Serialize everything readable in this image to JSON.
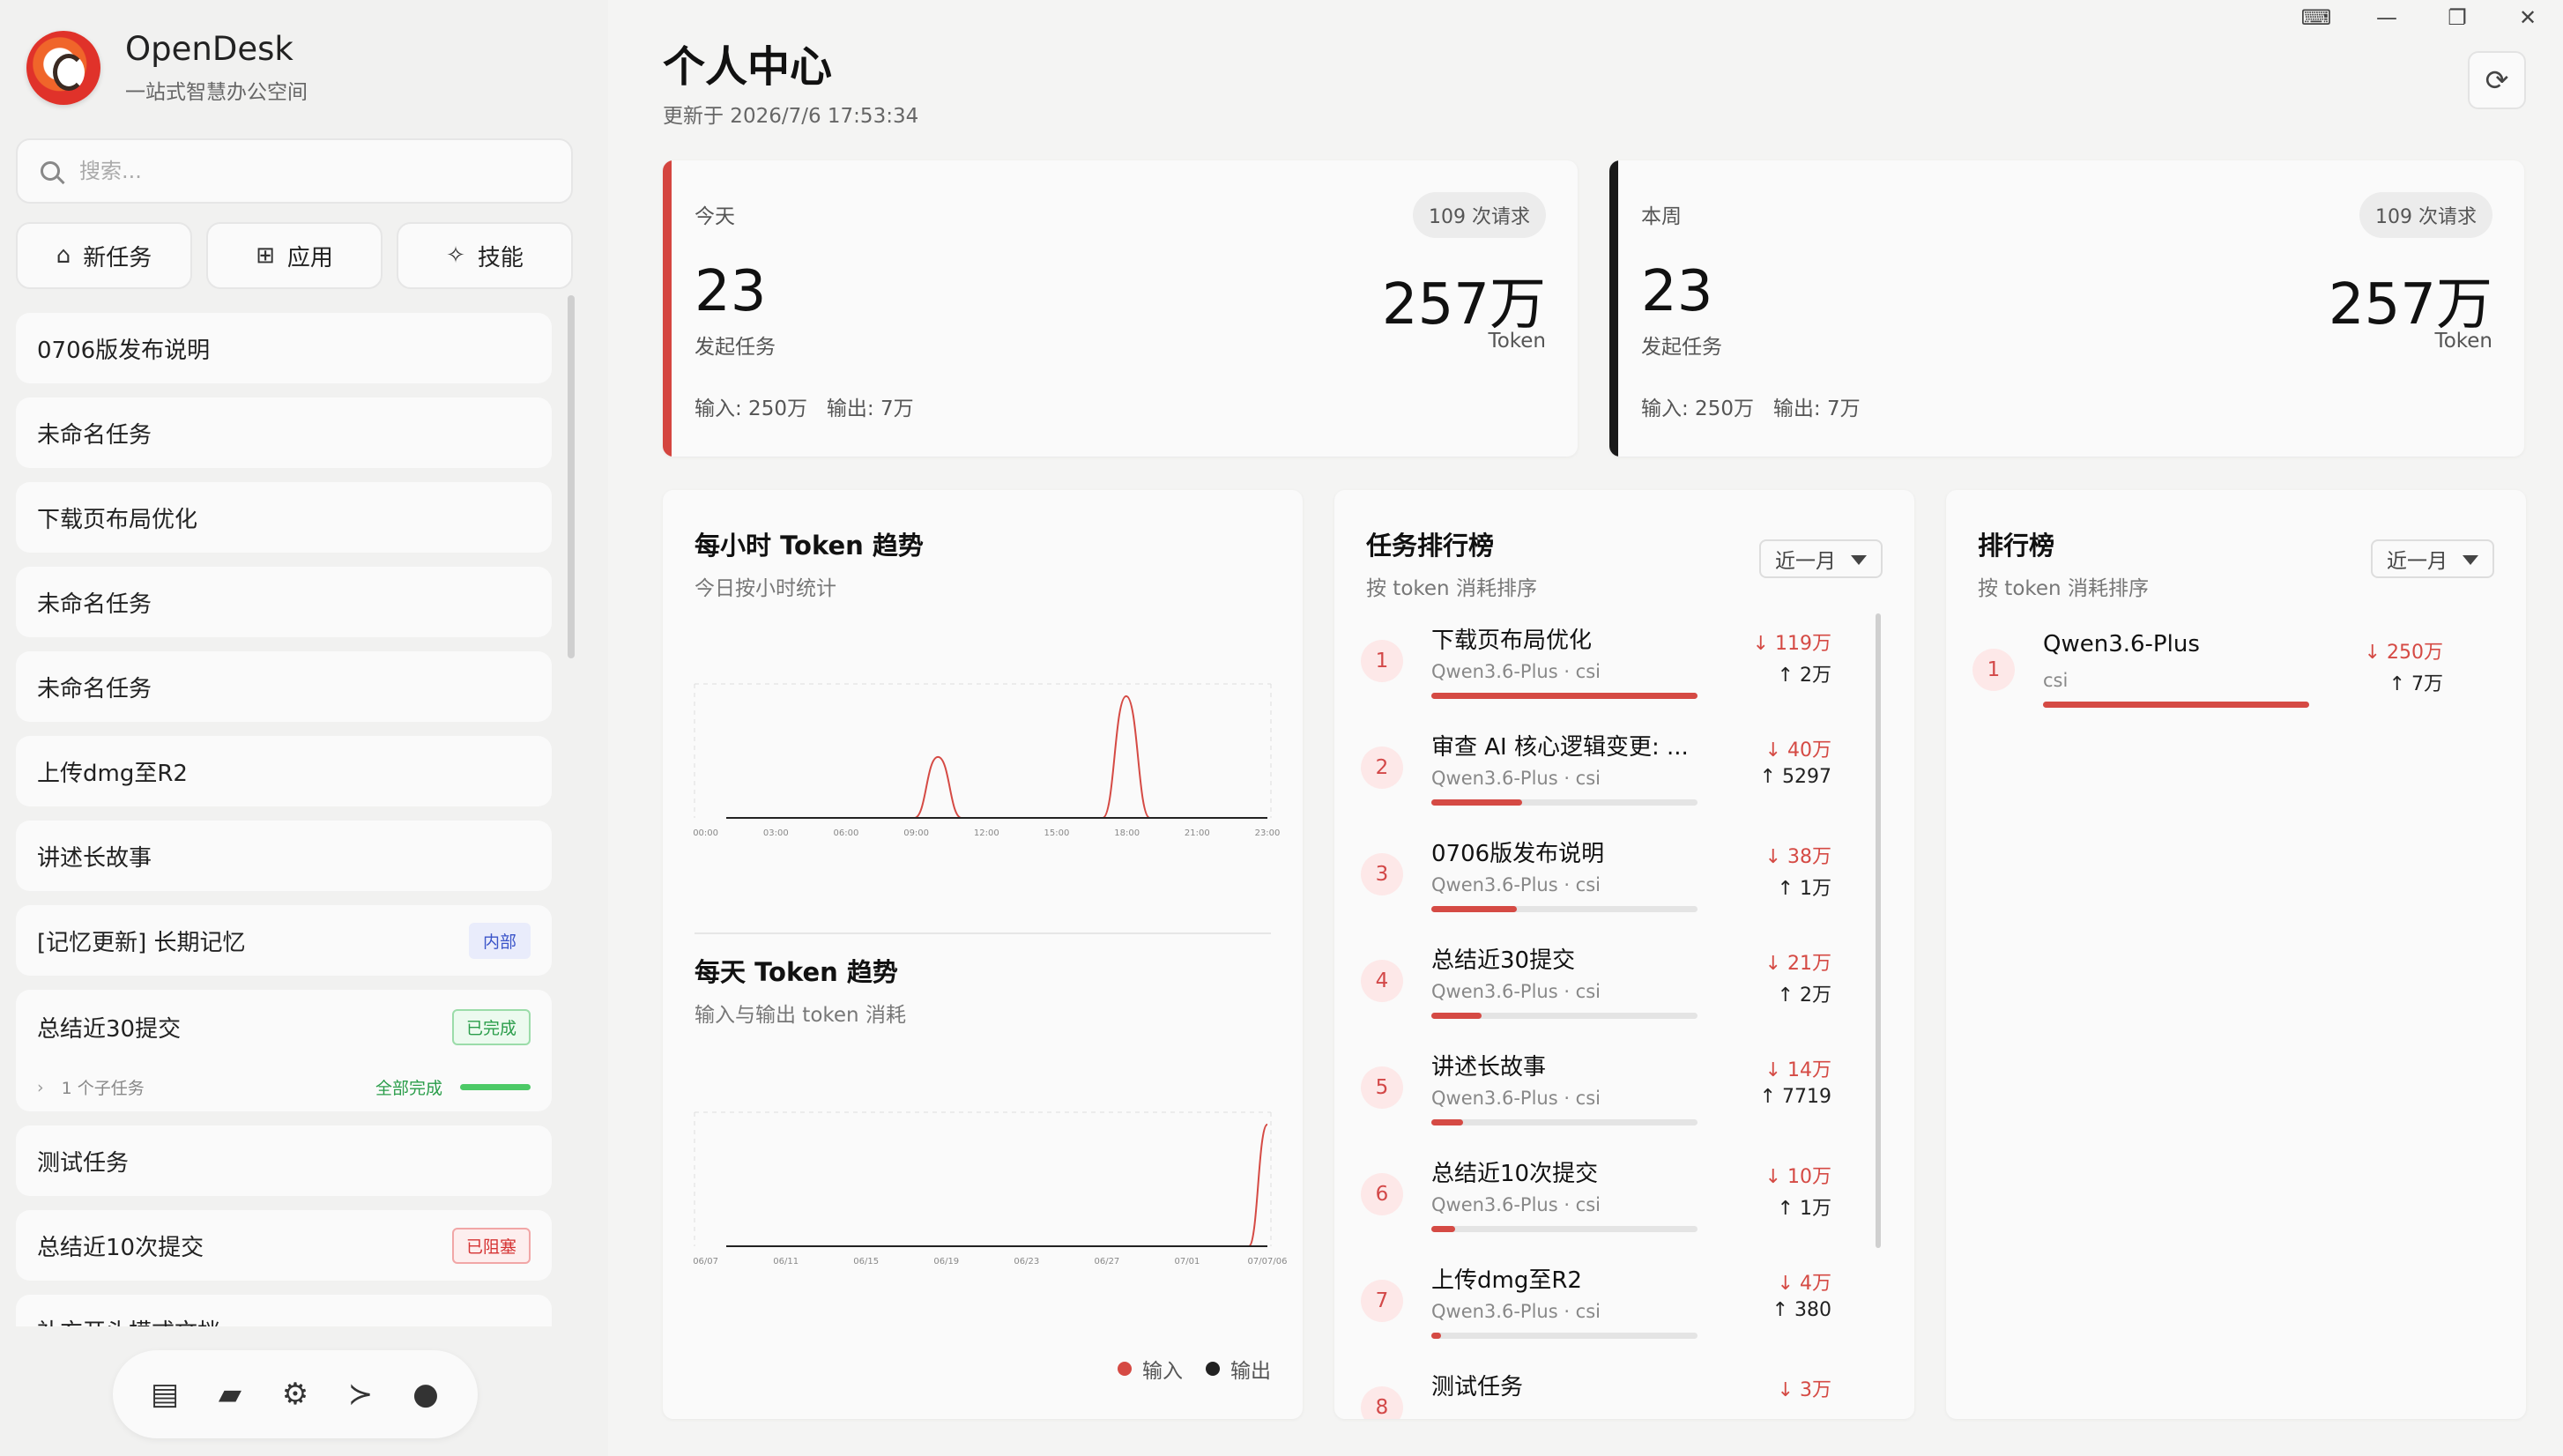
{
  "app": {
    "name": "OpenDesk",
    "tagline": "一站式智慧办公空间"
  },
  "search": {
    "placeholder": "搜索..."
  },
  "quick_actions": [
    {
      "icon": "home-icon",
      "label": "新任务"
    },
    {
      "icon": "grid-icon",
      "label": "应用"
    },
    {
      "icon": "magic-wand-icon",
      "label": "技能"
    }
  ],
  "tasks": [
    {
      "title": "0706版发布说明"
    },
    {
      "title": "未命名任务"
    },
    {
      "title": "下载页布局优化"
    },
    {
      "title": "未命名任务"
    },
    {
      "title": "未命名任务"
    },
    {
      "title": "上传dmg至R2"
    },
    {
      "title": "讲述长故事"
    },
    {
      "title": "[记忆更新] 长期记忆",
      "badge": "内部"
    },
    {
      "title": "总结近30提交",
      "badge": "已完成",
      "subtasks": "1 个子任务",
      "subtasks_status": "全部完成",
      "subtasks_progress": 1.0
    },
    {
      "title": "测试任务"
    },
    {
      "title": "总结近10次提交",
      "badge": "已阻塞"
    },
    {
      "title": "补充开头模式文档"
    }
  ],
  "dock": [
    "server-icon",
    "folder-icon",
    "gear-icon",
    "terminal-icon",
    "user-icon"
  ],
  "page": {
    "title": "个人中心",
    "updated": "更新于 2026/7/6 17:53:34"
  },
  "stats": [
    {
      "period": "今天",
      "requests": "109 次请求",
      "tasks": "23",
      "tasks_label": "发起任务",
      "tokens": "257万",
      "tokens_label": "Token",
      "input": "输入: 250万",
      "output": "输出: 7万",
      "accent": "#d4453f"
    },
    {
      "period": "本周",
      "requests": "109 次请求",
      "tasks": "23",
      "tasks_label": "发起任务",
      "tokens": "257万",
      "tokens_label": "Token",
      "input": "输入: 250万",
      "output": "输出: 7万",
      "accent": "#1a1a1a"
    }
  ],
  "hourly": {
    "title": "每小时 Token 趋势",
    "subtitle": "今日按小时统计",
    "chart_data": {
      "type": "line",
      "x": [
        "00:00",
        "03:00",
        "06:00",
        "09:00",
        "12:00",
        "15:00",
        "18:00",
        "21:00",
        "23:00"
      ],
      "series": [
        {
          "color": "#d54a44",
          "points": [
            [
              0,
              0
            ],
            [
              8,
              0
            ],
            [
              9,
              0.5
            ],
            [
              10,
              0
            ],
            [
              16,
              0
            ],
            [
              17,
              1.0
            ],
            [
              18,
              0
            ],
            [
              23,
              0
            ]
          ]
        },
        {
          "color": "#222222",
          "points": [
            [
              0,
              0
            ],
            [
              23,
              0
            ]
          ]
        }
      ],
      "ylim": [
        0,
        1.1
      ]
    }
  },
  "daily": {
    "title": "每天 Token 趋势",
    "subtitle": "输入与输出 token 消耗",
    "chart_data": {
      "type": "line",
      "x": [
        "06/07",
        "06/11",
        "06/15",
        "06/19",
        "06/23",
        "06/27",
        "07/01",
        "07/07/06"
      ],
      "series": [
        {
          "name": "输入",
          "color": "#d54a44",
          "points": [
            [
              0,
              0
            ],
            [
              28,
              0
            ],
            [
              29,
              1.0
            ]
          ]
        },
        {
          "name": "输出",
          "color": "#222222",
          "points": [
            [
              0,
              0
            ],
            [
              29,
              0
            ]
          ]
        }
      ],
      "ylim": [
        0,
        1.1
      ]
    },
    "legend": [
      {
        "label": "输入",
        "color": "#d54a44"
      },
      {
        "label": "输出",
        "color": "#222222"
      }
    ]
  },
  "task_rank": {
    "title": "任务排行榜",
    "subtitle": "按 token 消耗排序",
    "range": "近一月",
    "items": [
      {
        "rank": "1",
        "name": "下载页布局优化",
        "meta": "Qwen3.6-Plus · csi",
        "input": "↓ 119万",
        "output": "↑ 2万",
        "share": 1.0
      },
      {
        "rank": "2",
        "name": "审查 AI 核心逻辑变更: ...",
        "meta": "Qwen3.6-Plus · csi",
        "input": "↓ 40万",
        "output": "↑ 5297",
        "share": 0.34
      },
      {
        "rank": "3",
        "name": "0706版发布说明",
        "meta": "Qwen3.6-Plus · csi",
        "input": "↓ 38万",
        "output": "↑ 1万",
        "share": 0.32
      },
      {
        "rank": "4",
        "name": "总结近30提交",
        "meta": "Qwen3.6-Plus · csi",
        "input": "↓ 21万",
        "output": "↑ 2万",
        "share": 0.19
      },
      {
        "rank": "5",
        "name": "讲述长故事",
        "meta": "Qwen3.6-Plus · csi",
        "input": "↓ 14万",
        "output": "↑ 7719",
        "share": 0.12
      },
      {
        "rank": "6",
        "name": "总结近10次提交",
        "meta": "Qwen3.6-Plus · csi",
        "input": "↓ 10万",
        "output": "↑ 1万",
        "share": 0.09
      },
      {
        "rank": "7",
        "name": "上传dmg至R2",
        "meta": "Qwen3.6-Plus · csi",
        "input": "↓ 4万",
        "output": "↑ 380",
        "share": 0.035
      },
      {
        "rank": "8",
        "name": "测试任务",
        "meta": "",
        "input": "↓ 3万",
        "output": "",
        "share": 0.025
      }
    ]
  },
  "model_rank": {
    "title": "排行榜",
    "subtitle": "按 token 消耗排序",
    "range": "近一月",
    "items": [
      {
        "rank": "1",
        "name": "Qwen3.6-Plus",
        "meta": "csi",
        "input": "↓ 250万",
        "output": "↑ 7万",
        "share": 1.0
      }
    ]
  }
}
